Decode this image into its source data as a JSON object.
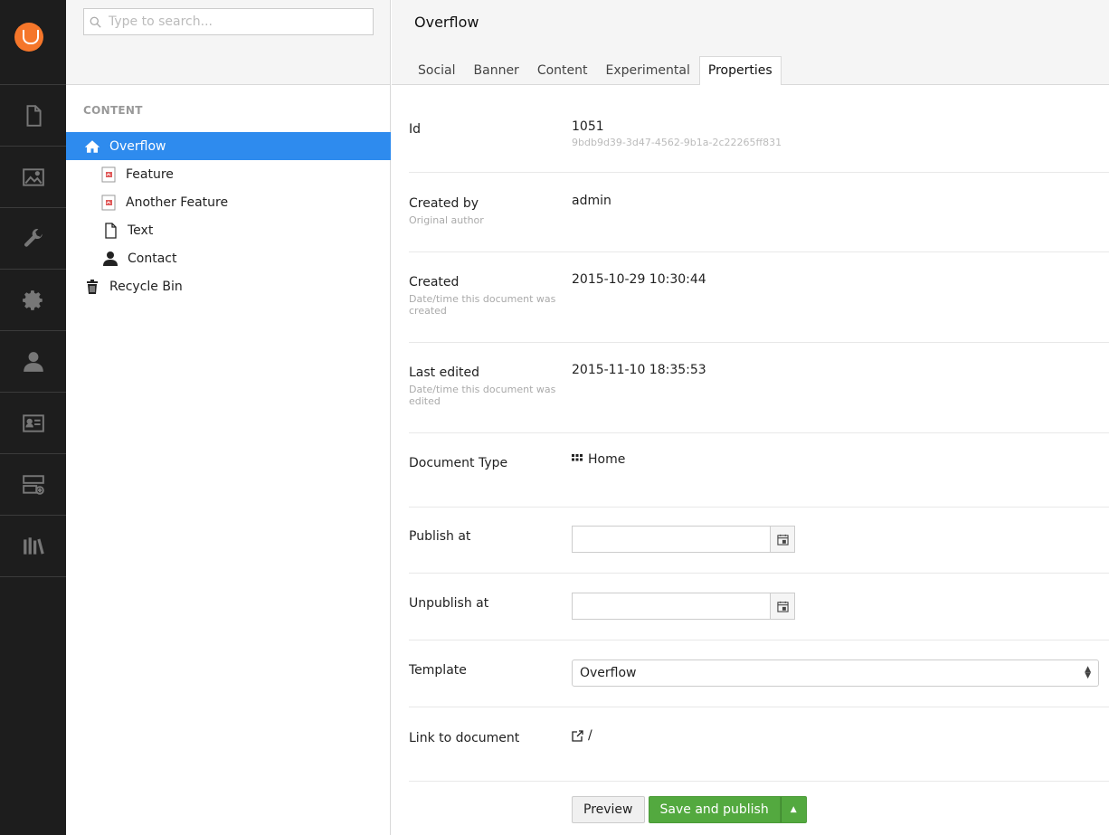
{
  "search": {
    "placeholder": "Type to search..."
  },
  "tree": {
    "section_title": "CONTENT",
    "items": [
      {
        "label": "Overflow",
        "icon": "home-icon"
      },
      {
        "label": "Feature",
        "icon": "feature-doc-icon"
      },
      {
        "label": "Another Feature",
        "icon": "feature-doc-icon"
      },
      {
        "label": "Text",
        "icon": "document-icon"
      },
      {
        "label": "Contact",
        "icon": "user-icon"
      },
      {
        "label": "Recycle Bin",
        "icon": "trash-icon"
      }
    ]
  },
  "rail": {
    "sections": [
      "content-icon",
      "media-icon",
      "settings-wrench-icon",
      "developer-gear-icon",
      "users-icon",
      "members-icon",
      "forms-icon",
      "dictionary-icon"
    ]
  },
  "document": {
    "title": "Overflow",
    "tabs": [
      "Social",
      "Banner",
      "Content",
      "Experimental",
      "Properties"
    ],
    "active_tab": "Properties"
  },
  "properties": {
    "id": {
      "label": "Id",
      "value": "1051",
      "guid": "9bdb9d39-3d47-4562-9b1a-2c22265ff831"
    },
    "created_by": {
      "label": "Created by",
      "description": "Original author",
      "value": "admin"
    },
    "created": {
      "label": "Created",
      "description": "Date/time this document was created",
      "value": "2015-10-29 10:30:44"
    },
    "last_edited": {
      "label": "Last edited",
      "description": "Date/time this document was edited",
      "value": "2015-11-10 18:35:53"
    },
    "document_type": {
      "label": "Document Type",
      "value": "Home"
    },
    "publish_at": {
      "label": "Publish at",
      "value": ""
    },
    "unpublish_at": {
      "label": "Unpublish at",
      "value": ""
    },
    "template": {
      "label": "Template",
      "value": "Overflow"
    },
    "link": {
      "label": "Link to document",
      "value": "/"
    }
  },
  "actions": {
    "preview": "Preview",
    "save_publish": "Save and publish"
  },
  "colors": {
    "accent": "#2e8bee",
    "brand": "#f5762a",
    "success": "#53a93f",
    "rail": "#1d1d1d"
  }
}
